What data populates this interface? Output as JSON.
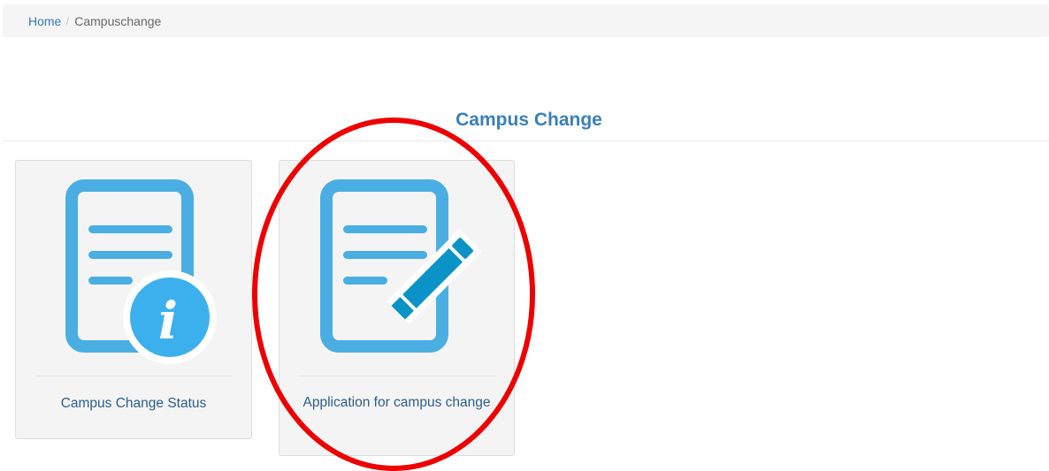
{
  "breadcrumb": {
    "home": "Home",
    "separator": "/",
    "current": "Campuschange"
  },
  "page": {
    "title": "Campus Change"
  },
  "tiles": [
    {
      "label": "Campus Change Status",
      "icon": "document-info-icon"
    },
    {
      "label": "Application for campus change",
      "icon": "document-edit-icon"
    }
  ],
  "annotation": {
    "type": "red-ellipse-highlight",
    "target": "Application for campus change"
  },
  "colors": {
    "link": "#337ab7",
    "title": "#3a80b8",
    "tile_label": "#2b5e8c",
    "icon_blue": "#4aaee3",
    "icon_blue_dark": "#0a93c6",
    "info_badge": "#3cb0ec",
    "highlight": "#ee0000"
  }
}
